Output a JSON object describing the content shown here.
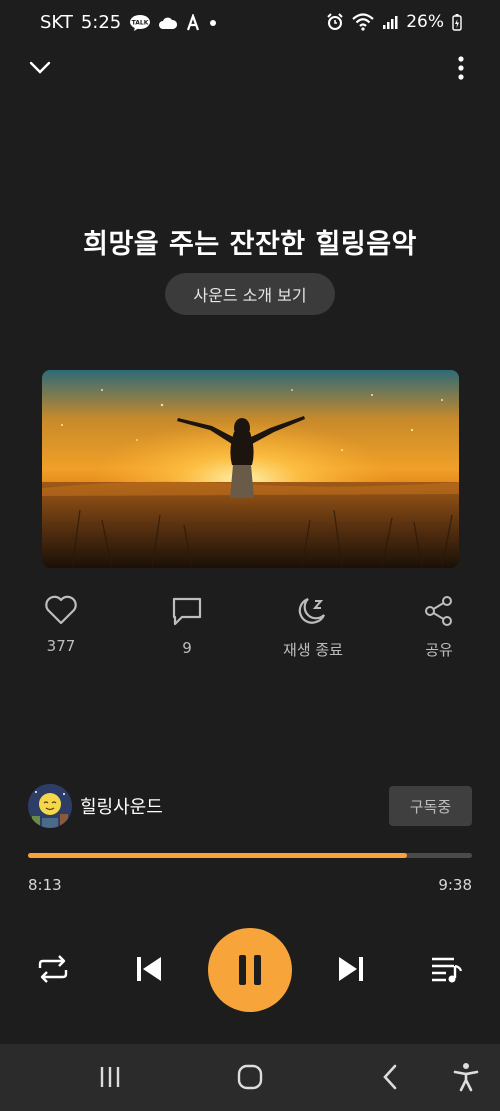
{
  "status_bar": {
    "carrier": "SKT",
    "time": "5:25",
    "talk_badge": "TALK",
    "battery": "26%"
  },
  "player": {
    "title": "희망을 주는 잔잔한 힐링음악",
    "intro_button": "사운드 소개 보기",
    "actions": [
      {
        "label": "377",
        "icon": "heart-icon"
      },
      {
        "label": "9",
        "icon": "comment-icon"
      },
      {
        "label": "재생 종료",
        "icon": "sleep-timer-icon"
      },
      {
        "label": "공유",
        "icon": "share-icon"
      }
    ],
    "channel": {
      "name": "힐링사운드",
      "subscribe_label": "구독중"
    },
    "progress": {
      "elapsed": "8:13",
      "total": "9:38",
      "fraction": 0.8529
    }
  },
  "colors": {
    "accent": "#f7a43a",
    "background": "#1d1d1d"
  }
}
